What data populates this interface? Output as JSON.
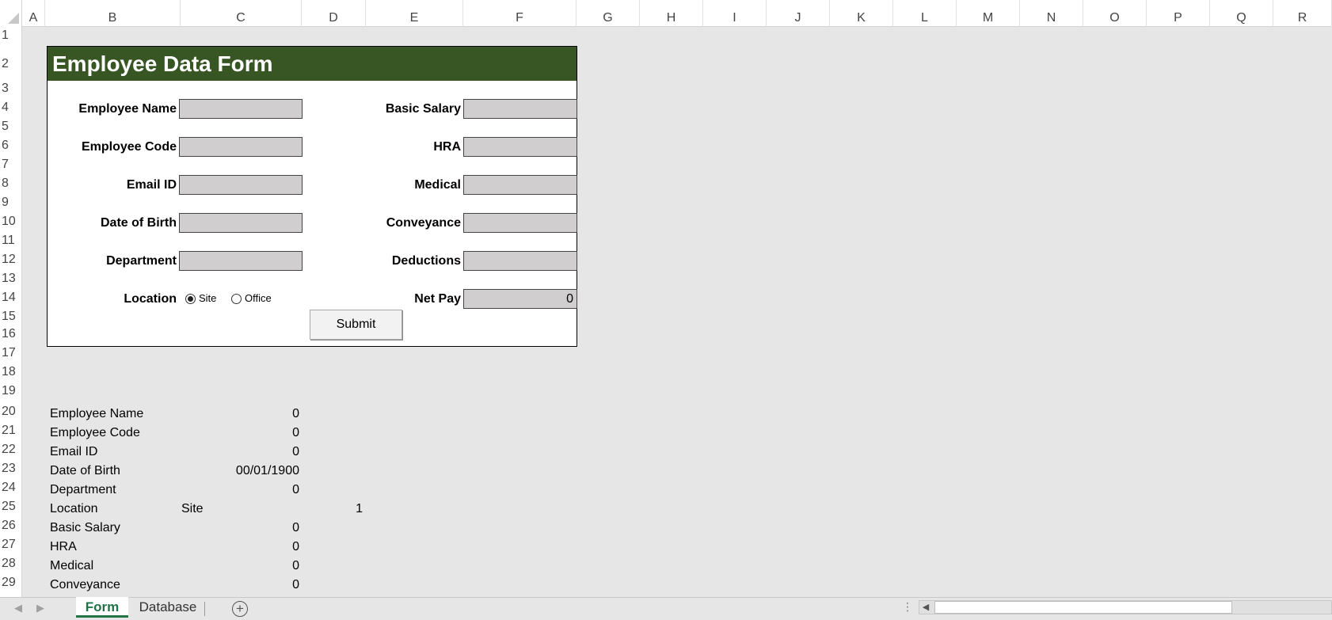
{
  "columns": [
    "A",
    "B",
    "C",
    "D",
    "E",
    "F",
    "G",
    "H",
    "I",
    "J",
    "K",
    "L",
    "M",
    "N",
    "O",
    "P",
    "Q",
    "R"
  ],
  "rows": [
    "1",
    "2",
    "3",
    "4",
    "5",
    "6",
    "7",
    "8",
    "9",
    "10",
    "11",
    "12",
    "13",
    "14",
    "15",
    "16",
    "17",
    "18",
    "19",
    "20",
    "21",
    "22",
    "23",
    "24",
    "25",
    "26",
    "27",
    "28",
    "29"
  ],
  "form": {
    "title": "Employee Data Form",
    "title_bar_color": "#375623",
    "left_fields": [
      {
        "label": "Employee Name",
        "value": ""
      },
      {
        "label": "Employee Code",
        "value": ""
      },
      {
        "label": "Email ID",
        "value": ""
      },
      {
        "label": "Date of Birth",
        "value": ""
      },
      {
        "label": "Department",
        "value": ""
      }
    ],
    "right_fields": [
      {
        "label": "Basic Salary",
        "value": ""
      },
      {
        "label": "HRA",
        "value": ""
      },
      {
        "label": "Medical",
        "value": ""
      },
      {
        "label": "Conveyance",
        "value": ""
      },
      {
        "label": "Deductions",
        "value": ""
      },
      {
        "label": "Net Pay",
        "value": "0"
      }
    ],
    "location": {
      "label": "Location",
      "options": [
        "Site",
        "Office"
      ],
      "selected": "Site"
    },
    "submit_label": "Submit"
  },
  "summary": [
    {
      "label": "Employee Name",
      "value": "0"
    },
    {
      "label": "Employee Code",
      "value": "0"
    },
    {
      "label": "Email ID",
      "value": "0"
    },
    {
      "label": "Date of Birth",
      "value": "00/01/1900"
    },
    {
      "label": "Department",
      "value": "0"
    },
    {
      "label": "Location",
      "value": "Site",
      "extra": "1"
    },
    {
      "label": "Basic Salary",
      "value": "0"
    },
    {
      "label": "HRA",
      "value": "0"
    },
    {
      "label": "Medical",
      "value": "0"
    },
    {
      "label": "Conveyance",
      "value": "0"
    }
  ],
  "sheets": {
    "tabs": [
      "Form",
      "Database"
    ],
    "active": "Form",
    "active_color": "#217346"
  }
}
